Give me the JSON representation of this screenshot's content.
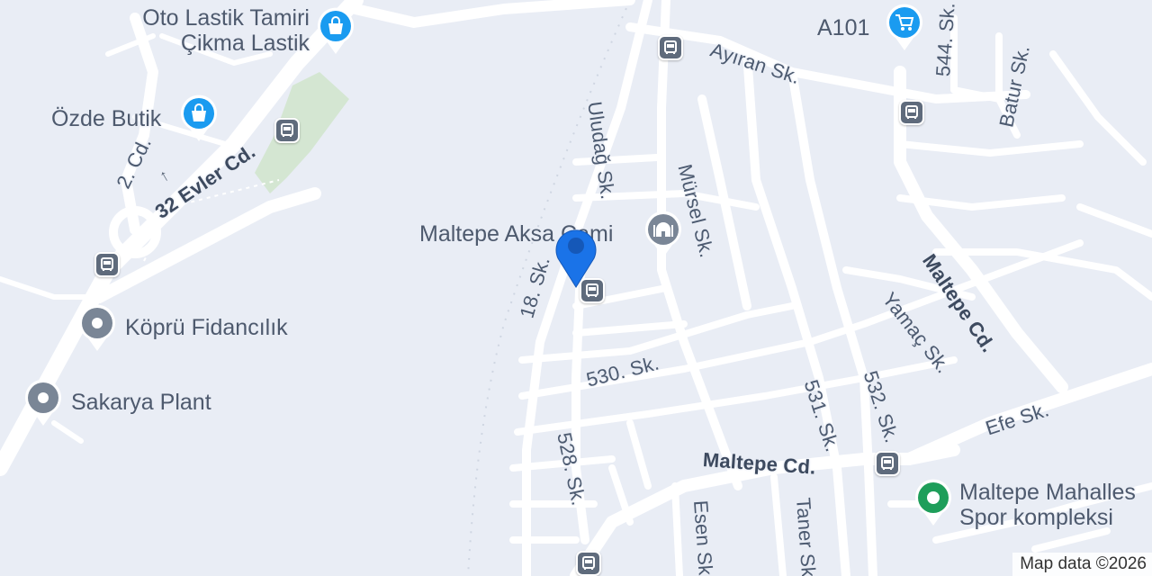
{
  "map": {
    "colors": {
      "background": "#e9edf5",
      "road": "#ffffff",
      "park": "#d4e6d2",
      "shopping_pin": "#1a9bf0",
      "generic_pin": "#7a8696",
      "sport_pin": "#1e9e5a",
      "location_marker": "#1a73e8",
      "transit_icon": "#5f6b7c"
    },
    "streets": {
      "uludag": "Uludağ Sk.",
      "ayiran": "Ayıran Sk.",
      "sk544": "544. Sk.",
      "batur": "Batur Sk.",
      "mursel": "Mürsel Sk.",
      "cd2": "2. Cd.",
      "evler32": "32 Evler Cd.",
      "maltepe_cd_right": "Maltepe Cd.",
      "yamac": "Yamaç Sk.",
      "sk18": "18. Sk.",
      "sk530": "530. Sk.",
      "sk531": "531. Sk.",
      "sk532": "532. Sk.",
      "efe": "Efe Sk.",
      "sk528": "528. Sk.",
      "maltepe_cd_main": "Maltepe Cd.",
      "esen": "Esen Sk.",
      "taner": "Taner Sk."
    },
    "pois": {
      "oto_lastik_line1": "Oto Lastik Tamiri",
      "oto_lastik_line2": "Çikma Lastik",
      "ozde_butik": "Özde Butik",
      "a101": "A101",
      "maltepe_cami": "Maltepe Aksa Cami",
      "kopru_fidancilik": "Köprü Fidancılık",
      "sakarya_plant": "Sakarya Plant",
      "maltepe_spor_line1": "Maltepe Mahalles",
      "maltepe_spor_line2": "Spor kompleksi"
    },
    "icons": {
      "shopping": "shopping-bag-icon",
      "cart": "shopping-cart-icon",
      "mosque": "mosque-icon",
      "generic": "place-icon",
      "sport": "sport-complex-icon",
      "bus": "bus-stop-icon",
      "marker": "location-marker-icon",
      "direction": "one-way-arrow-icon"
    },
    "attribution": "Map data ©2026"
  }
}
